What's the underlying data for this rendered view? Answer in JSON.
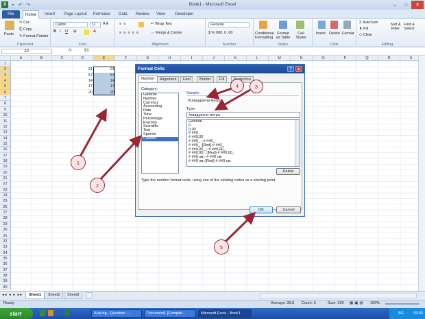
{
  "window": {
    "title": "Book1 - Microsoft Excel"
  },
  "ribbon": {
    "file_tab": "File",
    "tabs": [
      "Home",
      "Insert",
      "Page Layout",
      "Formulas",
      "Data",
      "Review",
      "View",
      "Developer"
    ],
    "clipboard": {
      "paste": "Paste",
      "cut": "Cut",
      "copy": "Copy",
      "format_painter": "Format Painter",
      "label": "Clipboard"
    },
    "font": {
      "name": "Calibri",
      "size": "11",
      "label": "Font"
    },
    "alignment": {
      "wrap": "Wrap Text",
      "merge": "Merge & Center",
      "label": "Alignment"
    },
    "number": {
      "format": "General",
      "label": "Number"
    },
    "styles": {
      "cond": "Conditional Formatting",
      "table": "Format as Table",
      "cell": "Cell Styles",
      "label": "Styles"
    },
    "cells": {
      "insert": "Insert",
      "delete": "Delete",
      "format": "Format",
      "label": "Cells"
    },
    "editing": {
      "autosum": "AutoSum",
      "fill": "Fill",
      "clear": "Clear",
      "sort": "Sort & Filter",
      "find": "Find & Select",
      "label": "Editing"
    }
  },
  "formula_bar": {
    "name_box": "E2",
    "fx": "fx",
    "value": "91"
  },
  "grid": {
    "columns": [
      "A",
      "B",
      "C",
      "D",
      "E",
      "F",
      "G",
      "H",
      "I",
      "J",
      "K",
      "L",
      "M",
      "N",
      "O",
      "P",
      "Q",
      "R",
      "S",
      "T"
    ],
    "rows": [
      "1",
      "2",
      "3",
      "4",
      "5",
      "6",
      "7",
      "8",
      "9",
      "10",
      "11",
      "12",
      "13",
      "14",
      "15",
      "16",
      "17",
      "18",
      "19",
      "20",
      "21",
      "22",
      "23",
      "24",
      "25",
      "26",
      "27",
      "28",
      "29",
      "30",
      "31",
      "32",
      "33",
      "34",
      "35",
      "36",
      "37",
      "38",
      "39",
      "40"
    ],
    "d_values": [
      "91",
      "57",
      "14",
      "17",
      "20"
    ],
    "e_values": [
      "91",
      "57",
      "14",
      "17",
      "20"
    ]
  },
  "sheets": [
    "Sheet1",
    "Sheet2",
    "Sheet3"
  ],
  "status": {
    "ready": "Ready",
    "average": "Average: 39,8",
    "count": "Count: 5",
    "sum": "Sum: 199",
    "zoom": "100%"
  },
  "taskbar": {
    "start": "start",
    "items": [
      "Aula.bg - Question - ...",
      "Document1 [Compati...",
      "Microsoft Excel - Book1"
    ],
    "lang": "BG",
    "time": "09:02"
  },
  "dialog": {
    "title": "Format Cells",
    "tabs": [
      "Number",
      "Alignment",
      "Font",
      "Border",
      "Fill",
      "Protection"
    ],
    "category_label": "Category:",
    "categories": [
      "General",
      "Number",
      "Currency",
      "Accounting",
      "Date",
      "Time",
      "Percentage",
      "Fraction",
      "Scientific",
      "Text",
      "Special",
      "Custom"
    ],
    "selected_category": "Custom",
    "sample_label": "Sample",
    "sample_value": "91квадратни метра",
    "type_label": "Type:",
    "type_value": "#квадратни метра",
    "type_list": [
      "General",
      "0",
      "0,00",
      "# ##0",
      "# ##0,00",
      "# ##0_ ;-# ##0_ ",
      "# ##0_ ;[Red]-# ##0_ ",
      "# ##0,00_ ;-# ##0,00_ ",
      "# ##0,00_ ;[Red]-# ##0,00_ ",
      "# ##0 лв.;-# ##0 лв.",
      "# ##0 лв.;[Red]-# ##0 лв."
    ],
    "delete": "Delete",
    "hint": "Type the number format code, using one of the existing codes as a starting point.",
    "ok": "OK",
    "cancel": "Cancel"
  },
  "callouts": [
    "1",
    "2",
    "3",
    "4",
    "5"
  ],
  "colors": {
    "accent": "#2c5ba6",
    "callout": "#9b2535",
    "selection": "#b8cce4"
  }
}
